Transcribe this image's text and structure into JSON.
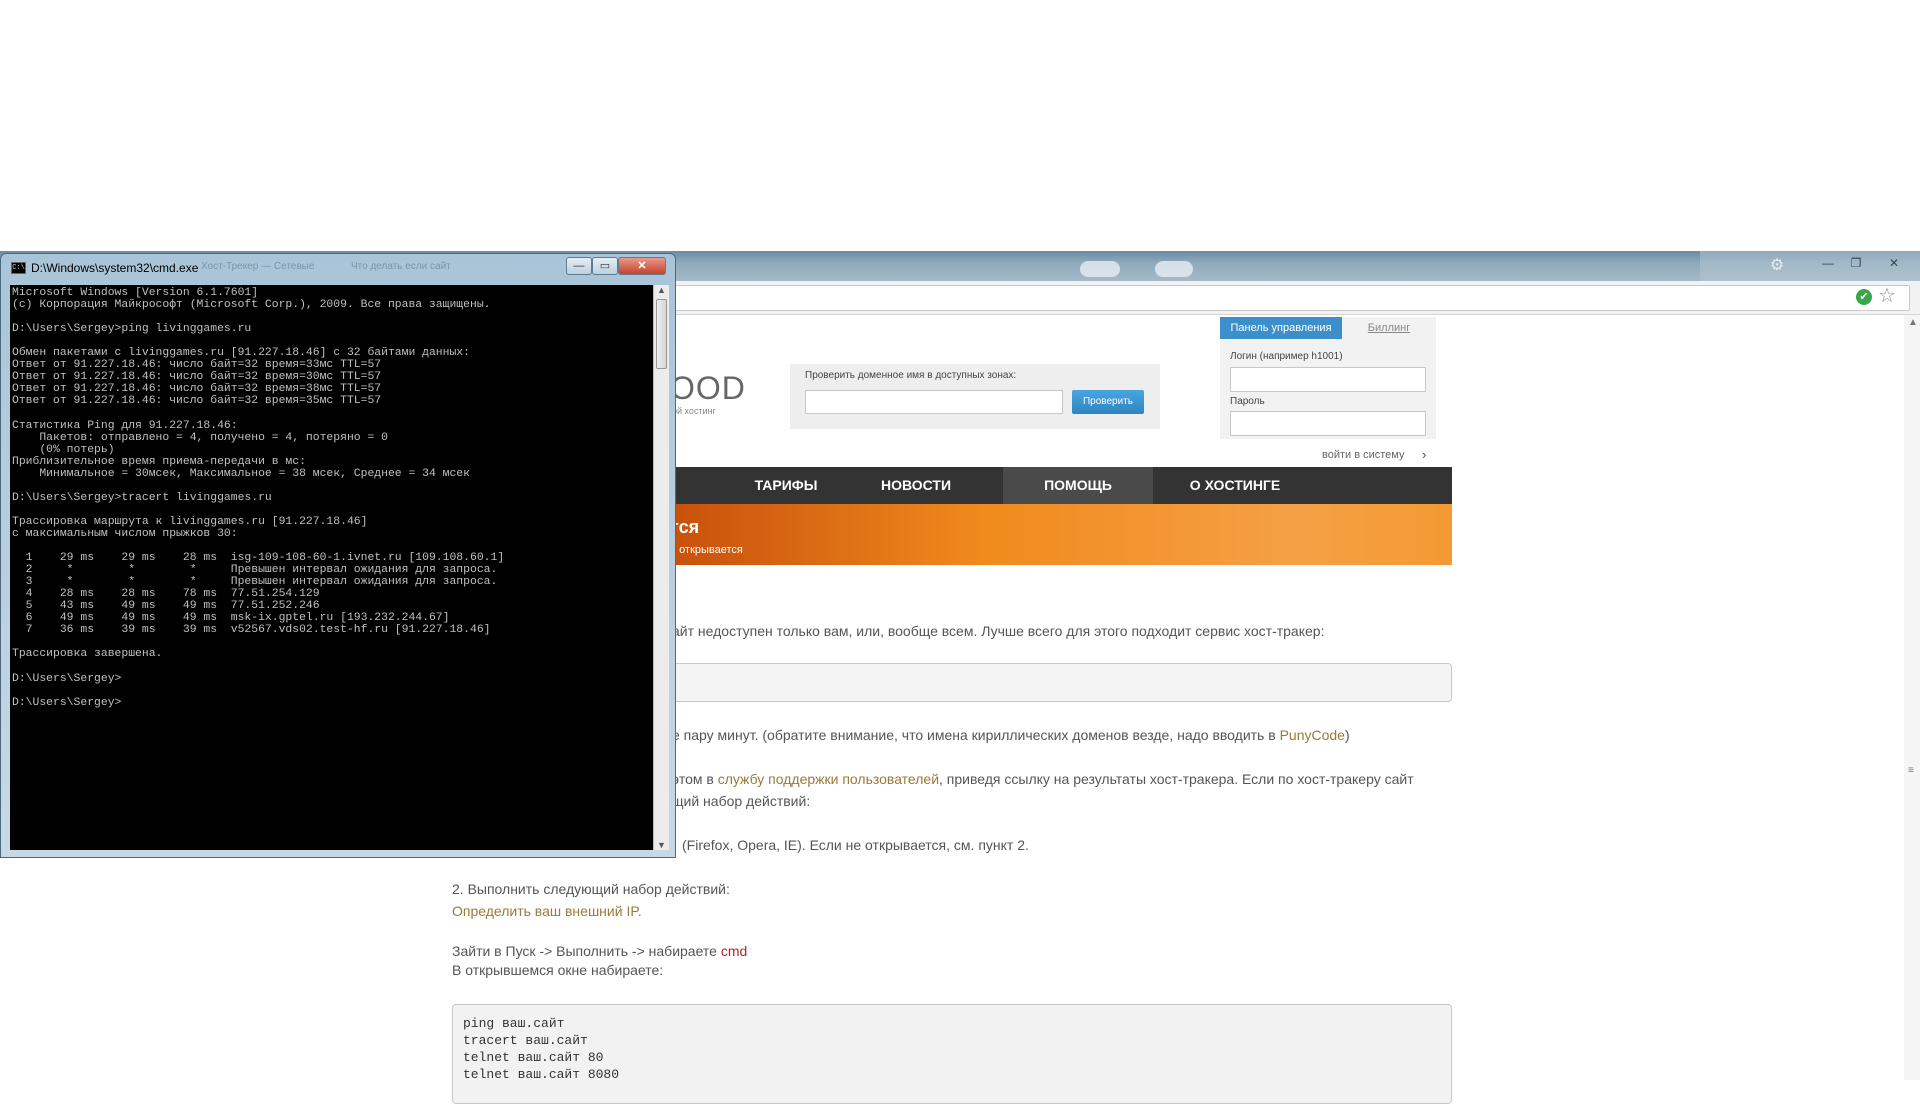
{
  "cmd": {
    "title": "D:\\Windows\\system32\\cmd.exe",
    "icon_text": "C:\\",
    "ghost_tab1": "Хост-Трекер — Сетевые",
    "ghost_tab2": "Что делать если сайт",
    "minimize": "—",
    "maximize": "▭",
    "close": "✕",
    "output": "Microsoft Windows [Version 6.1.7601]\n(c) Корпорация Майкрософт (Microsoft Corp.), 2009. Все права защищены.\n\nD:\\Users\\Sergey>ping livinggames.ru\n\nОбмен пакетами с livinggames.ru [91.227.18.46] с 32 байтами данных:\nОтвет от 91.227.18.46: число байт=32 время=33мс TTL=57\nОтвет от 91.227.18.46: число байт=32 время=30мс TTL=57\nОтвет от 91.227.18.46: число байт=32 время=38мс TTL=57\nОтвет от 91.227.18.46: число байт=32 время=35мс TTL=57\n\nСтатистика Ping для 91.227.18.46:\n    Пакетов: отправлено = 4, получено = 4, потеряно = 0\n    (0% потерь)\nПриблизительное время приема-передачи в мс:\n    Минимальное = 30мсек, Максимальное = 38 мсек, Среднее = 34 мсек\n\nD:\\Users\\Sergey>tracert livinggames.ru\n\nТрассировка маршрута к livinggames.ru [91.227.18.46]\nс максимальным числом прыжков 30:\n\n  1    29 ms    29 ms    28 ms  isg-109-108-60-1.ivnet.ru [109.108.60.1]\n  2     *        *        *     Превышен интервал ожидания для запроса.\n  3     *        *        *     Превышен интервал ожидания для запроса.\n  4    28 ms    28 ms    78 ms  77.51.254.129\n  5    43 ms    49 ms    49 ms  77.51.252.246\n  6    49 ms    49 ms    49 ms  msk-ix.gptel.ru [193.232.244.67]\n  7    36 ms    39 ms    39 ms  v52567.vds02.test-hf.ru [91.227.18.46]\n\nТрассировка завершена.\n\nD:\\Users\\Sergey>\n\nD:\\Users\\Sergey>"
  },
  "browser": {
    "gear_icon": "⚙",
    "minimize": "—",
    "restore": "❐",
    "close": "✕",
    "secure_icon": "✔",
    "star_icon": "☆"
  },
  "site": {
    "logo": "OOD",
    "logo_sub": "ой хостинг",
    "domain_check": {
      "label": "Проверить доменное имя в доступных зонах:",
      "button": "Проверить"
    },
    "control_panel": {
      "tab_active": "Панель управления",
      "tab_other": "Биллинг",
      "login_label": "Логин (например h1001)",
      "password_label": "Пароль",
      "login_link": "войти в систему",
      "arrow": "›"
    },
    "nav": [
      "ТАРИФЫ",
      "НОВОСТИ",
      "ПОМОЩЬ",
      "О ХОСТИНГЕ"
    ],
    "banner_title": "тся",
    "banner_sub": "е открывается",
    "text1": "айт недоступен только вам, или, вообще всем. Лучше всего для этого подходит сервис хост-тракер:",
    "text2a": "е пару минут. (обратите внимание, что имена кириллических доменов везде, надо вводить в ",
    "text2_link": "PunyCode",
    "text2b": ")",
    "text3a": "этом в ",
    "text3_link": "службу поддержки пользователей",
    "text3b": ", приведя ссылку на результаты хост-тракера. Если по хост-тракеру сайт",
    "text4": "щий набор действий:",
    "text5": "(Firefox, Opera, IE). Если не открывается, см. пункт 2.",
    "text6": "2. Выполнить следующий набор действий:",
    "text7_link": "Определить ваш внешний IP.",
    "text8a": "Зайти в Пуск -> Выполнить -> набираете ",
    "text8_cmd": "cmd",
    "text9": "В открывшемся окне набираете:",
    "code": [
      "ping ваш.сайт",
      "tracert ваш.сайт",
      "telnet ваш.сайт 80",
      "telnet ваш.сайт 8080"
    ]
  }
}
